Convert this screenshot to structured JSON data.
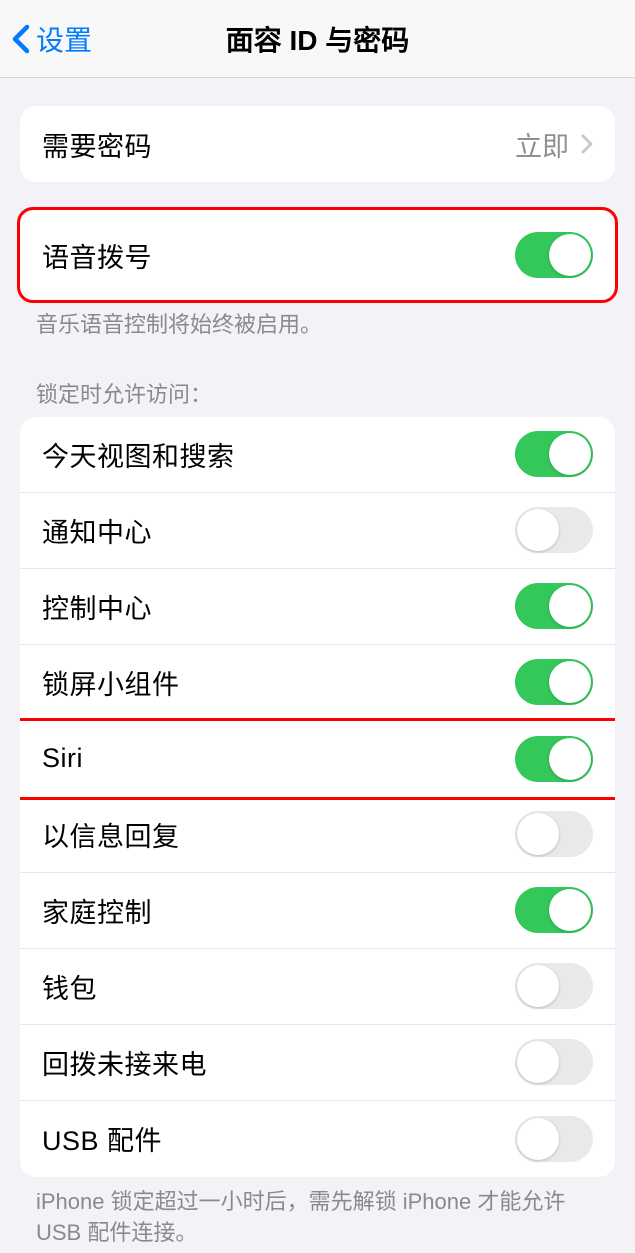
{
  "nav": {
    "back_label": "设置",
    "title": "面容 ID 与密码"
  },
  "group_passcode": {
    "require_label": "需要密码",
    "require_value": "立即"
  },
  "group_voice": {
    "voice_dial_label": "语音拨号",
    "voice_dial_on": true,
    "footer": "音乐语音控制将始终被启用。"
  },
  "section_lock_header": "锁定时允许访问：",
  "lock_items": [
    {
      "label": "今天视图和搜索",
      "on": true
    },
    {
      "label": "通知中心",
      "on": false
    },
    {
      "label": "控制中心",
      "on": true
    },
    {
      "label": "锁屏小组件",
      "on": true
    },
    {
      "label": "Siri",
      "on": true
    },
    {
      "label": "以信息回复",
      "on": false
    },
    {
      "label": "家庭控制",
      "on": true
    },
    {
      "label": "钱包",
      "on": false
    },
    {
      "label": "回拨未接来电",
      "on": false
    },
    {
      "label": "USB 配件",
      "on": false
    }
  ],
  "usb_footer": "iPhone 锁定超过一小时后，需先解锁 iPhone 才能允许 USB 配件连接。"
}
